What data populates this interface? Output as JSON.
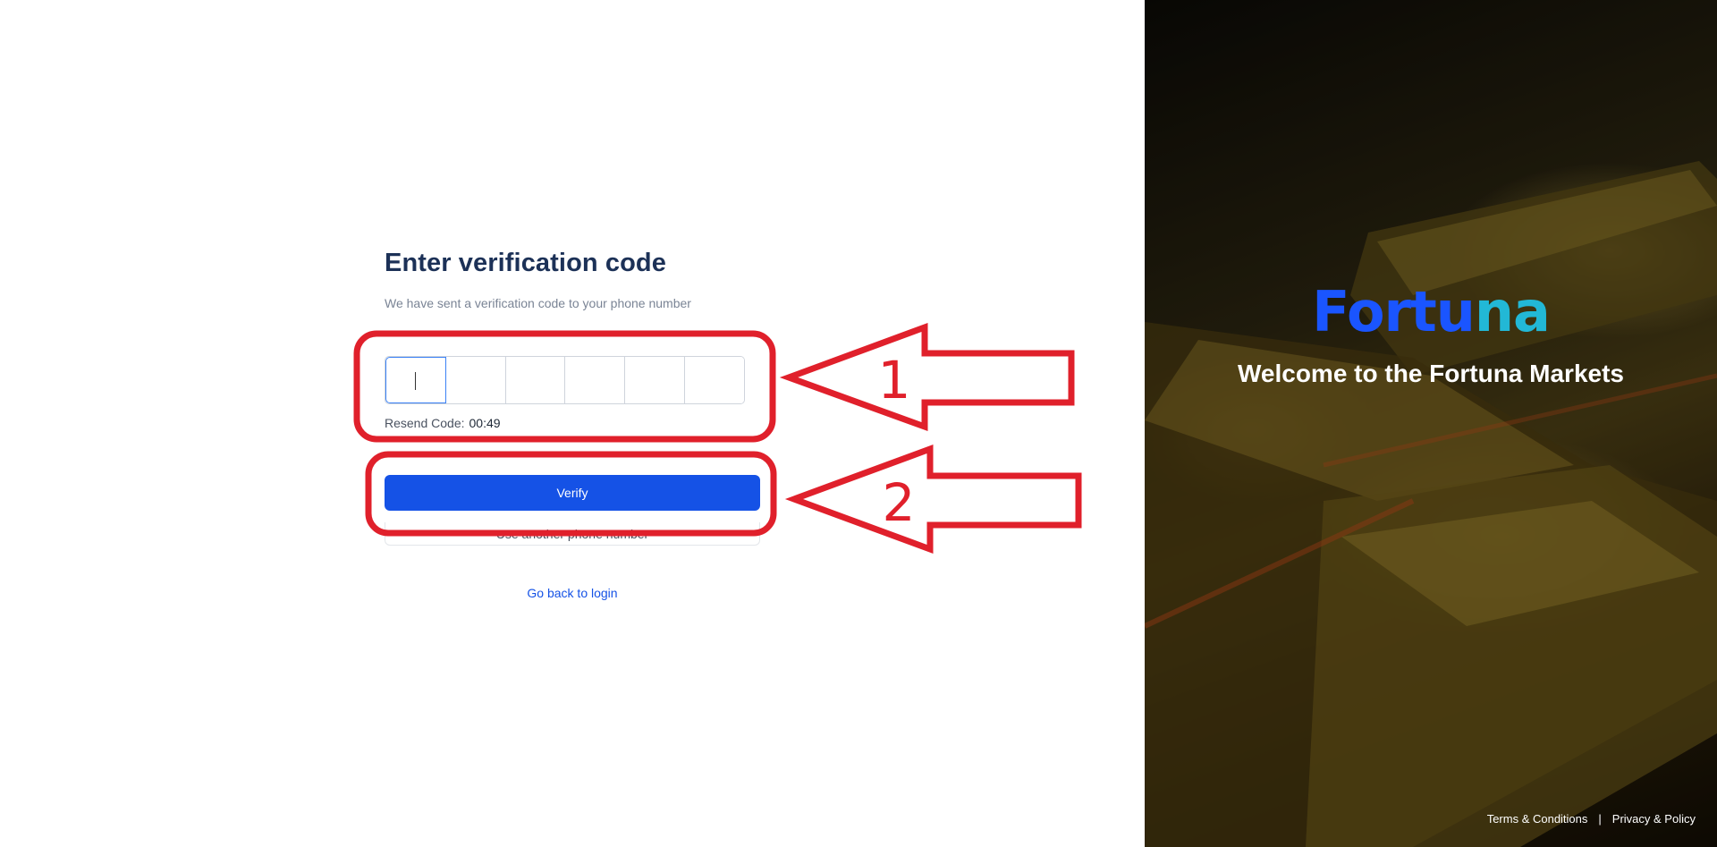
{
  "verification": {
    "title": "Enter verification code",
    "subtitle": "We have sent a verification code to your phone number",
    "code_cells": [
      "",
      "",
      "",
      "",
      "",
      ""
    ],
    "resend_label": "Resend Code:",
    "resend_timer": "00:49",
    "verify_label": "Verify",
    "alt_phone_label": "Use another phone number",
    "back_label": "Go back to login"
  },
  "annotations": {
    "label_1": "1",
    "label_2": "2",
    "color": "#e0202b"
  },
  "brand": {
    "logo_main": "Fortu",
    "logo_accent": "na",
    "welcome": "Welcome to the Fortuna Markets",
    "primary_color": "#1552e6"
  },
  "footer": {
    "terms": "Terms & Conditions",
    "separator": "|",
    "privacy": "Privacy & Policy"
  }
}
